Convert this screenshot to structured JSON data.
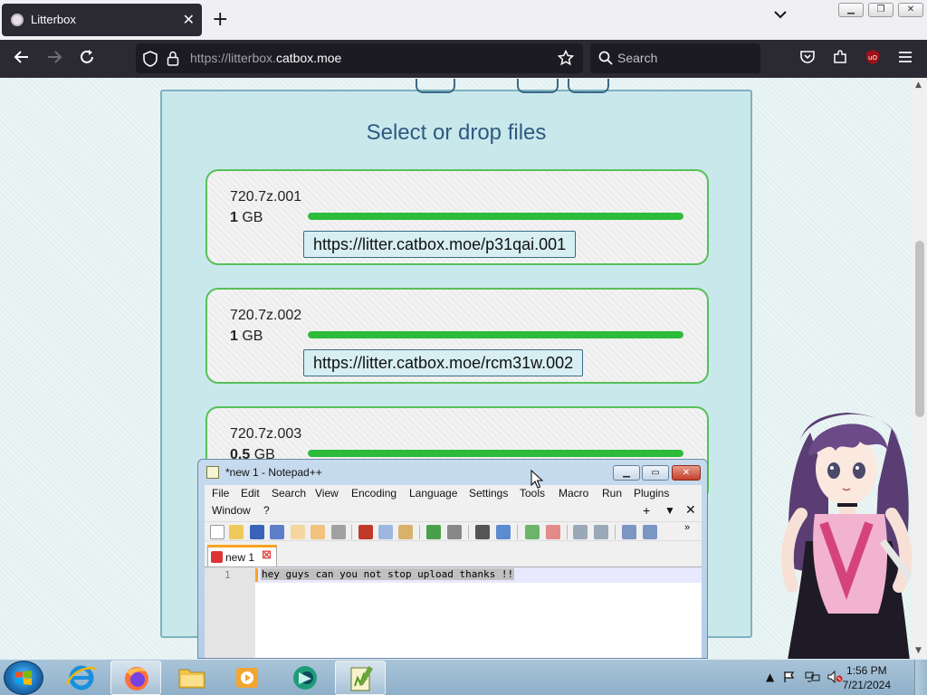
{
  "browser": {
    "tab_title": "Litterbox",
    "url_prefix": "https://litterbox.",
    "url_host": "catbox.moe",
    "search_placeholder": "Search",
    "ublock_badge": "uO"
  },
  "page": {
    "heading": "Select or drop files",
    "files": [
      {
        "name": "720.7z.001",
        "size_value": "1",
        "size_unit": " GB",
        "progress": 1.0,
        "link": "https://litter.catbox.moe/p31qai.001"
      },
      {
        "name": "720.7z.002",
        "size_value": "1",
        "size_unit": " GB",
        "progress": 1.0,
        "link": "https://litter.catbox.moe/rcm31w.002"
      },
      {
        "name": "720.7z.003",
        "size_value": "0.5",
        "size_unit": " GB",
        "progress": 1.0,
        "link": ""
      }
    ]
  },
  "notepad": {
    "title": "*new 1 - Notepad++",
    "menu": [
      "File",
      "Edit",
      "Search",
      "View",
      "Encoding",
      "Language",
      "Settings",
      "Tools",
      "Macro",
      "Run",
      "Plugins",
      "Window",
      "?"
    ],
    "tab_label": "new 1",
    "line_number": "1",
    "content": "hey guys can you not stop upload thanks !!"
  },
  "taskbar": {
    "time": "1:56 PM",
    "date": "7/21/2024"
  },
  "colors": {
    "panel": "#c9e8ec",
    "card_border": "#56c158",
    "progress": "#2dbb3c",
    "heading": "#2e5a80",
    "firefox_dark": "#2b2a33"
  }
}
